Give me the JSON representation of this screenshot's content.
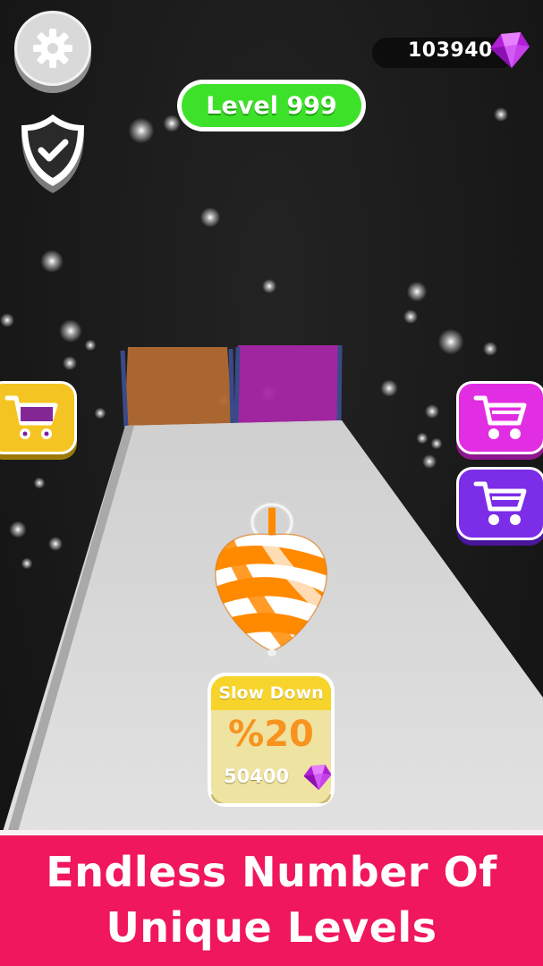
{
  "hud": {
    "gem_count": "103940",
    "level_label": "Level 999",
    "settings_icon": "gear-icon",
    "shield_icon": "shield-check-icon",
    "gem_icon": "gem-icon"
  },
  "shop_buttons": [
    {
      "name": "shop-button-yellow",
      "icon": "cart-icon",
      "color": "#f4c522"
    },
    {
      "name": "shop-button-pink",
      "icon": "cart-icon",
      "color": "#e22ee2"
    },
    {
      "name": "shop-button-purple",
      "icon": "cart-icon",
      "color": "#7b2de8"
    }
  ],
  "gates": [
    {
      "color": "#b26a33"
    },
    {
      "color": "#a827a8"
    }
  ],
  "upgrade": {
    "title": "Slow Down",
    "value": "%20",
    "cost": "50400",
    "currency_icon": "gem-icon"
  },
  "player": {
    "object": "spinning-top",
    "colors": [
      "#ff8a00",
      "#ffffff"
    ]
  },
  "banner": {
    "line1": "Endless Number Of",
    "line2": "Unique Levels",
    "color": "#f0175c"
  }
}
